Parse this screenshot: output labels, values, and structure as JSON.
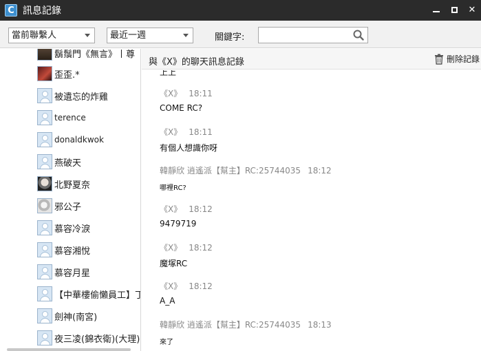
{
  "window": {
    "title": "訊息記錄",
    "min": "",
    "max": "",
    "close": "✕"
  },
  "filters": {
    "contact_scope": "當前聯繫人",
    "period": "最近一週",
    "keyword_label": "關鍵字:",
    "keyword_value": ""
  },
  "contacts": [
    {
      "name": "鬍鬚門《無言》丨尊",
      "avatar": "photo-top"
    },
    {
      "name": "歪歪.*",
      "avatar": "photo-a"
    },
    {
      "name": "被遺忘的炸雞",
      "avatar": "default"
    },
    {
      "name": "terence",
      "avatar": "default"
    },
    {
      "name": "donaldkwok",
      "avatar": "default"
    },
    {
      "name": "燕破天",
      "avatar": "default"
    },
    {
      "name": "北野夏奈",
      "avatar": "photo-b"
    },
    {
      "name": "邪公子",
      "avatar": "photo-c"
    },
    {
      "name": "慕容冷淚",
      "avatar": "default"
    },
    {
      "name": "慕容湘悅",
      "avatar": "default"
    },
    {
      "name": "慕容月星",
      "avatar": "default"
    },
    {
      "name": "【中華樓偷懶員工】丁",
      "avatar": "default"
    },
    {
      "name": "劍神(南宮)",
      "avatar": "default"
    },
    {
      "name": "夜三凌(錦衣衛)(大理)",
      "avatar": "default"
    }
  ],
  "chat": {
    "title": "與《X》的聊天訊息記錄",
    "delete_label": "刪除記錄",
    "cut_text": "上上",
    "messages": [
      {
        "sender": "《X》",
        "time": "18:11",
        "text": "COME RC?"
      },
      {
        "sender": "《X》",
        "time": "18:11",
        "text": "有個人想識你呀"
      },
      {
        "sender": "韓靜欣 逍遙派【幫主】RC:25744035",
        "time": "18:12",
        "text": "哪裡RC?"
      },
      {
        "sender": "《X》",
        "time": "18:12",
        "text": "9479719"
      },
      {
        "sender": "《X》",
        "time": "18:12",
        "text": "魔塚RC"
      },
      {
        "sender": "《X》",
        "time": "18:12",
        "text": "A_A"
      },
      {
        "sender": "韓靜欣 逍遙派【幫主】RC:25744035",
        "time": "18:13",
        "text": "來了"
      }
    ]
  },
  "colors": {
    "titlebar": "#2b2b2b",
    "accent": "#3d8fcf",
    "meta": "#888888"
  }
}
